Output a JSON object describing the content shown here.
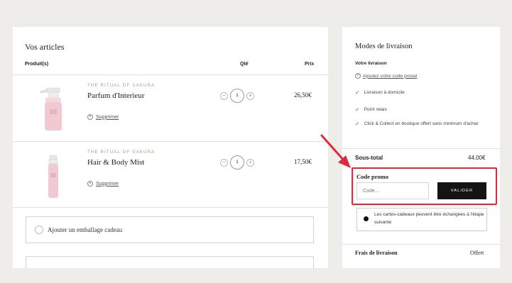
{
  "cart": {
    "title": "Vos articles",
    "headers": {
      "product": "Produit(s)",
      "qty": "Qté",
      "price": "Prix"
    },
    "items": [
      {
        "brand": "THE RITUAL OF SAKURA",
        "name": "Parfum d'Interieur",
        "remove": "Supprimer",
        "qty": "1",
        "price": "26,50€"
      },
      {
        "brand": "THE RITUAL OF SAKURA",
        "name": "Hair & Body Mist",
        "remove": "Supprimer",
        "qty": "1",
        "price": "17,50€"
      }
    ],
    "gift_wrap": "Ajouter un emballage cadeau"
  },
  "sidebar": {
    "title": "Modes de livraison",
    "delivery_sub": "Votre livraison",
    "postal_link": "Ajoutez votre code postal",
    "options": [
      "Livraison à domicile",
      "Point relais",
      "Click & Collect en boutique offert sans minimum d'achat"
    ],
    "subtotal_label": "Sous-total",
    "subtotal_value": "44,00€",
    "promo": {
      "title": "Code promo",
      "placeholder": "Code...",
      "button": "VALIDER"
    },
    "info_text": "Les cartes-cadeaux peuvent être échangées à l'étape suivante",
    "shipping_label": "Frais de livraison",
    "shipping_value": "Offert"
  },
  "colors": {
    "highlight": "#e02a3c",
    "button": "#141414",
    "brand": "#b19a8a"
  },
  "icons": {
    "check": "check-icon",
    "plus": "plus-icon",
    "minus": "minus-icon"
  }
}
